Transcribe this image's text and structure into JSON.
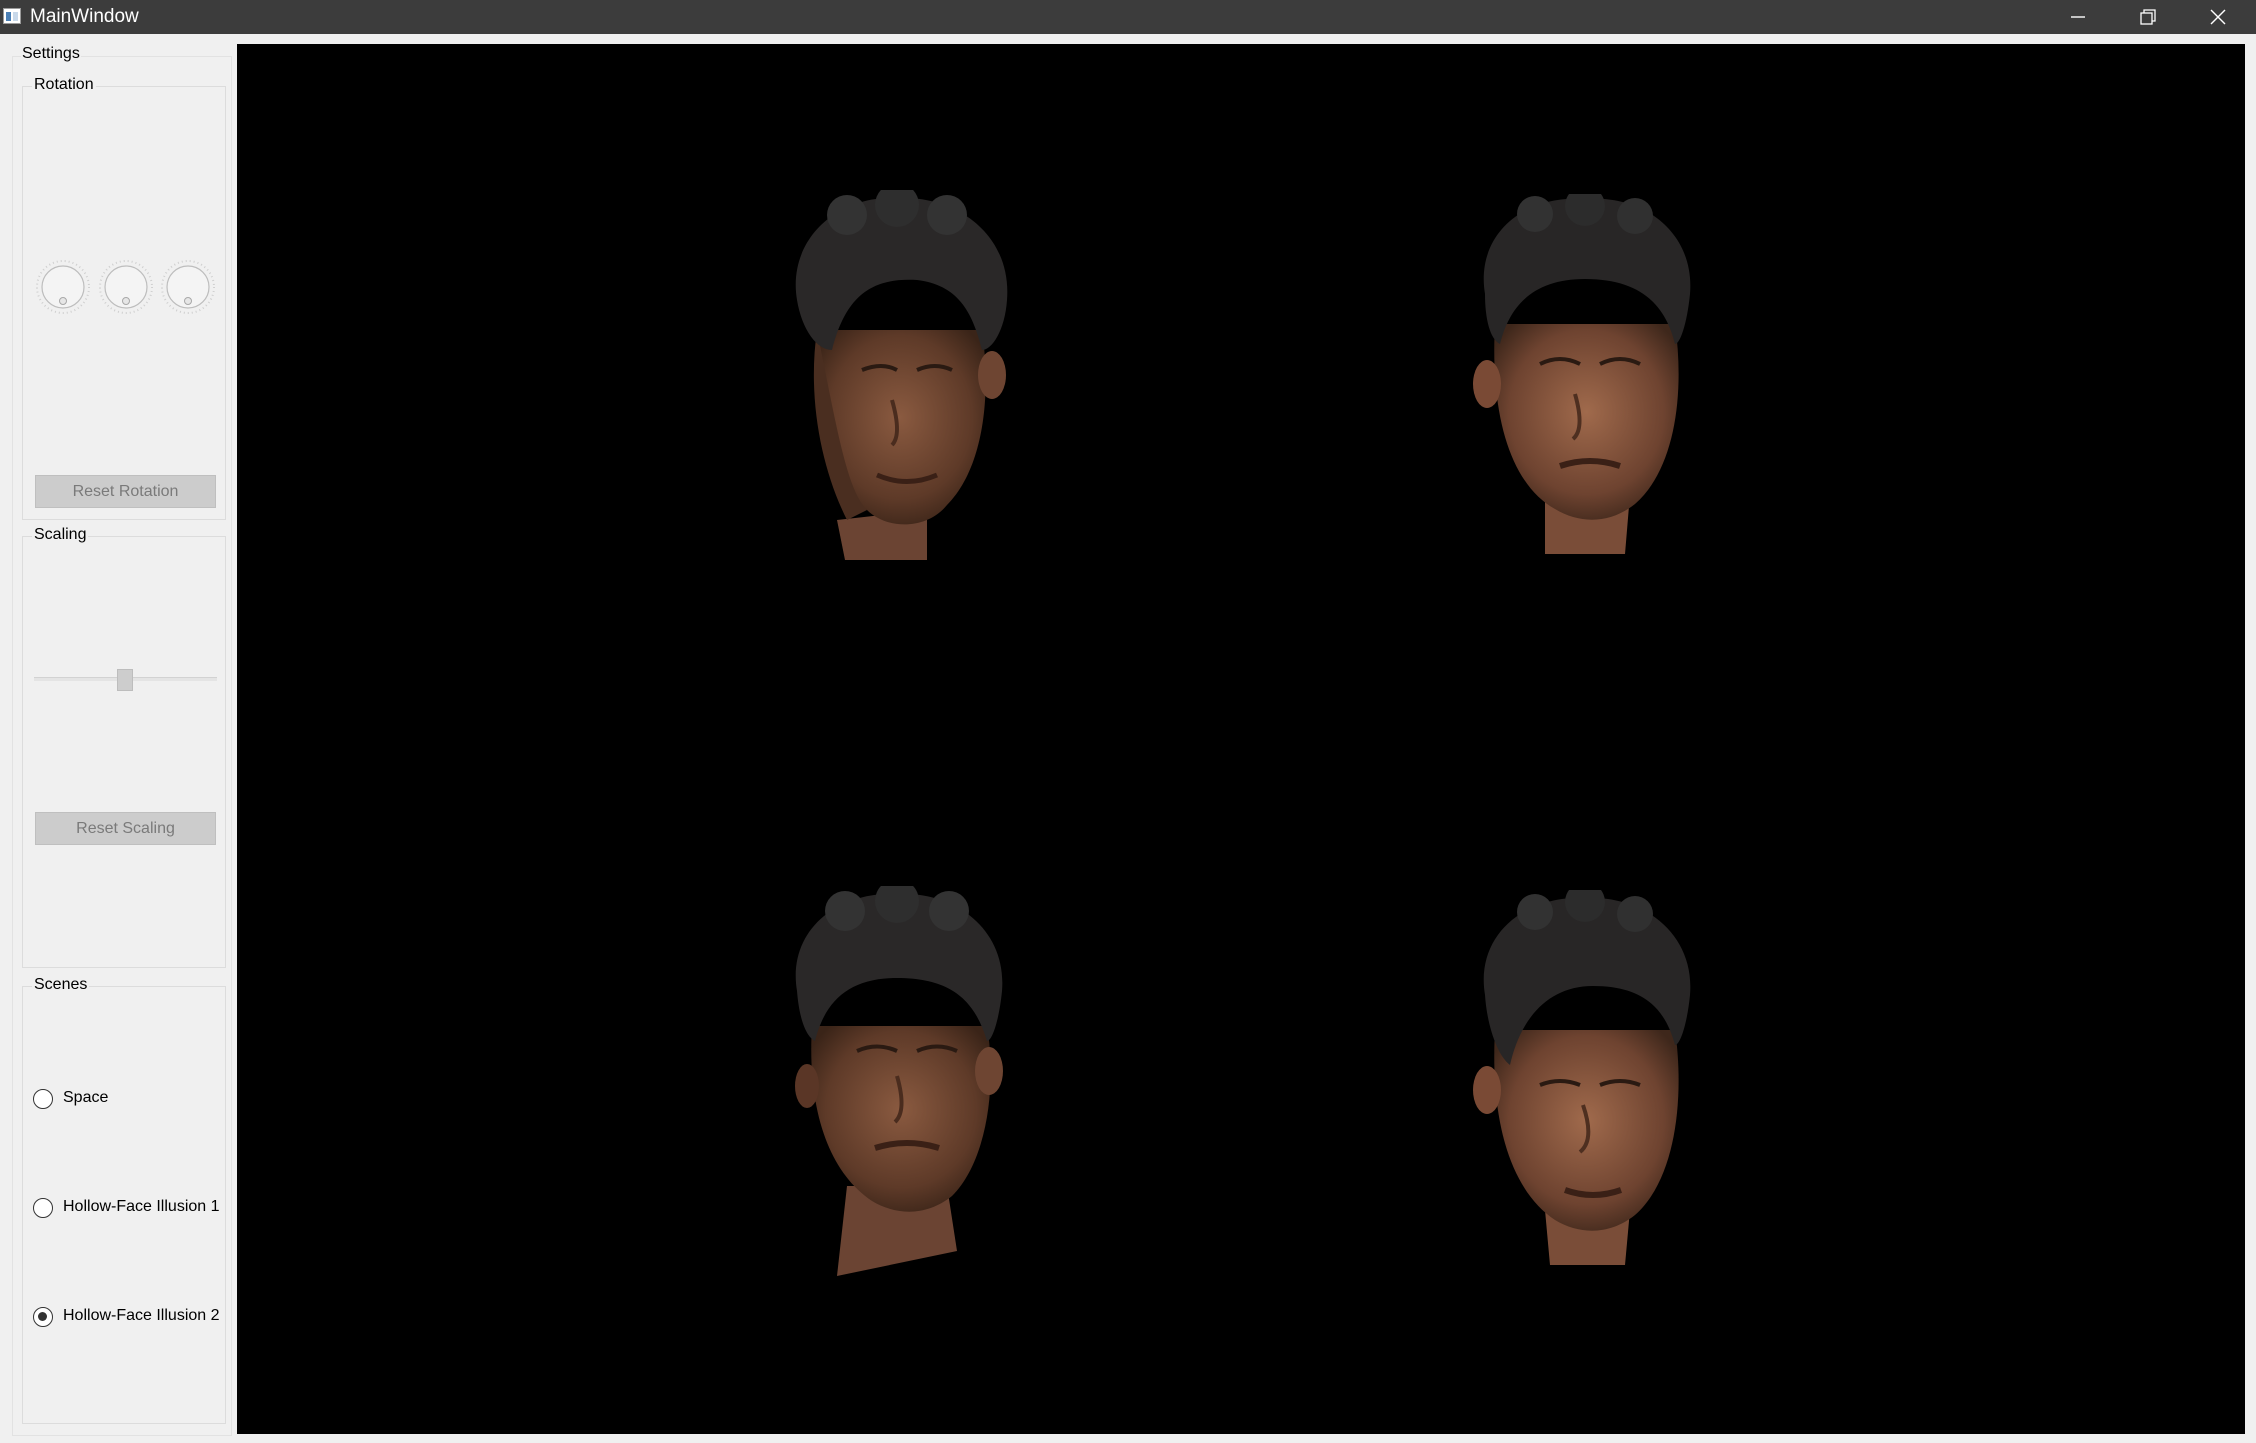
{
  "window": {
    "title": "MainWindow",
    "icon": "app-window-icon",
    "controls": [
      "minimize-icon",
      "restore-icon",
      "close-icon"
    ]
  },
  "settings": {
    "title": "Settings",
    "rotation": {
      "title": "Rotation",
      "dials": [
        "rotation-x-dial",
        "rotation-y-dial",
        "rotation-z-dial"
      ],
      "reset_label": "Reset Rotation",
      "reset_enabled": false
    },
    "scaling": {
      "title": "Scaling",
      "slider_value_fraction": 0.5,
      "reset_label": "Reset Scaling",
      "reset_enabled": false
    },
    "scenes": {
      "title": "Scenes",
      "options": [
        {
          "label": "Space",
          "checked": false
        },
        {
          "label": "Hollow-Face Illusion 1",
          "checked": false
        },
        {
          "label": "Hollow-Face Illusion 2",
          "checked": true
        }
      ]
    }
  },
  "viewport": {
    "background": "#000000",
    "views": [
      "head-view-top-left",
      "head-view-top-right",
      "head-view-bottom-left",
      "head-view-bottom-right"
    ]
  }
}
